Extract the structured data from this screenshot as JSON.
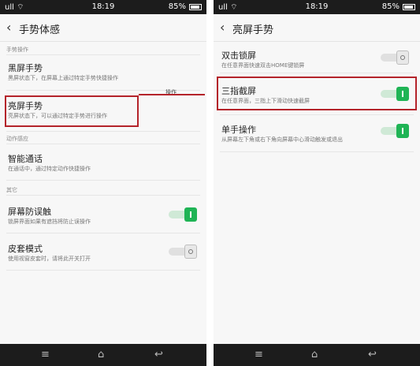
{
  "status": {
    "signal": "ull ⌔",
    "time": "18:19",
    "battery": "85%"
  },
  "left": {
    "title": "手势体感",
    "section_gesture": "手势操作",
    "items": [
      {
        "title": "黑屏手势",
        "subtitle": "黑屏状态下，在屏幕上通过特定手势快捷操作"
      },
      {
        "title": "亮屏手势",
        "subtitle": "亮屏状态下，可以通过特定手势进行操作"
      }
    ],
    "ghost_text": "操作",
    "section_motion": "动作感应",
    "smart_call": {
      "title": "智能通话",
      "subtitle": "在通话中，通过特定动作快捷操作"
    },
    "section_other": "其它",
    "anti_touch": {
      "title": "屏幕防误触",
      "subtitle": "锁屏界面如果有遮挡将防止误操作",
      "on": true
    },
    "cover_mode": {
      "title": "皮套模式",
      "subtitle": "使用视窗皮套时，请将此开关打开",
      "on": false
    }
  },
  "right": {
    "title": "亮屏手势",
    "items": [
      {
        "title": "双击锁屏",
        "subtitle": "在任意界面快速双击HOME键锁屏",
        "on": false
      },
      {
        "title": "三指截屏",
        "subtitle": "在任意界面，三指上下滑动快速截屏",
        "on": true
      },
      {
        "title": "单手操作",
        "subtitle": "从屏幕左下角或右下角向屏幕中心滑动触发或退出",
        "on": true
      }
    ]
  },
  "nav": {
    "menu": "≡",
    "home": "⌂",
    "back": "↩"
  },
  "colors": {
    "accent_green": "#1fb455",
    "highlight_red": "#b4232a"
  }
}
